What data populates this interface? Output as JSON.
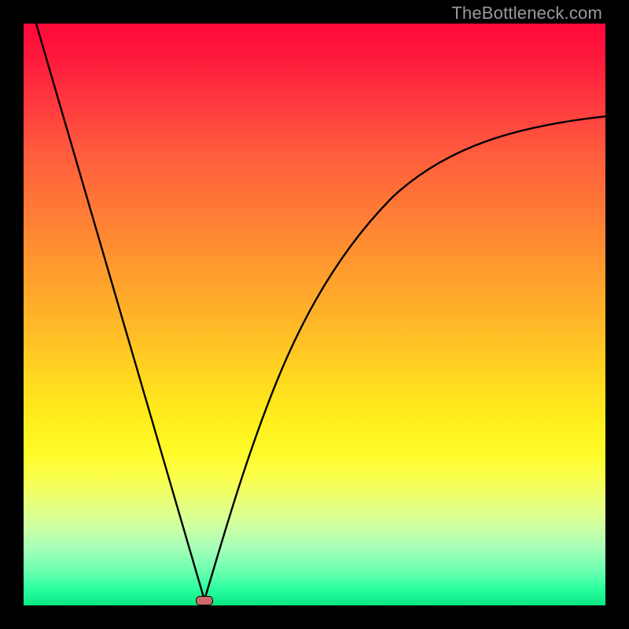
{
  "watermark": "TheBottleneck.com",
  "chart_data": {
    "type": "line",
    "title": "",
    "xlabel": "",
    "ylabel": "",
    "xlim": [
      0,
      100
    ],
    "ylim": [
      0,
      100
    ],
    "grid": false,
    "legend": false,
    "background_gradient": {
      "top_color": "#ff073a",
      "mid_color": "#ffd520",
      "bottom_color": "#08e884"
    },
    "series": [
      {
        "name": "left-branch",
        "x": [
          2,
          6,
          10,
          14,
          18,
          22,
          26,
          28,
          30,
          31
        ],
        "y": [
          100,
          86,
          72,
          58,
          44,
          30,
          16,
          9,
          3,
          1
        ]
      },
      {
        "name": "right-branch",
        "x": [
          31,
          33,
          36,
          40,
          45,
          50,
          56,
          63,
          72,
          82,
          92,
          100
        ],
        "y": [
          1,
          6,
          15,
          26,
          37,
          46,
          54,
          62,
          70,
          76,
          81,
          84
        ]
      }
    ],
    "marker": {
      "name": "optimal-point",
      "x": 31,
      "y": 1,
      "color": "#cc6a6a"
    }
  }
}
